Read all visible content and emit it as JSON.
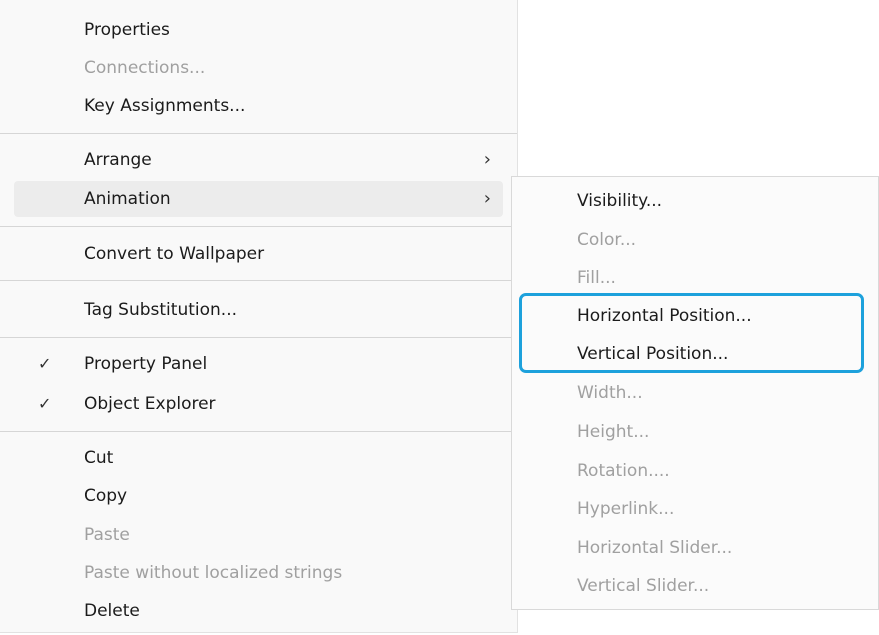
{
  "context_menu": {
    "items": [
      {
        "label": "Properties",
        "enabled": true
      },
      {
        "label": "Connections...",
        "enabled": false
      },
      {
        "label": "Key Assignments...",
        "enabled": true
      },
      {
        "label": "Arrange",
        "enabled": true,
        "submenu": true
      },
      {
        "label": "Animation",
        "enabled": true,
        "submenu": true,
        "hovered": true
      },
      {
        "label": "Convert to Wallpaper",
        "enabled": true
      },
      {
        "label": "Tag Substitution...",
        "enabled": true
      },
      {
        "label": "Property Panel",
        "enabled": true,
        "checked": true
      },
      {
        "label": "Object Explorer",
        "enabled": true,
        "checked": true
      },
      {
        "label": "Cut",
        "enabled": true
      },
      {
        "label": "Copy",
        "enabled": true
      },
      {
        "label": "Paste",
        "enabled": false
      },
      {
        "label": "Paste without localized strings",
        "enabled": false
      },
      {
        "label": "Delete",
        "enabled": true
      }
    ],
    "check_glyph": "✓",
    "chevron_glyph": "›"
  },
  "animation_submenu": {
    "items": [
      {
        "label": "Visibility...",
        "enabled": true
      },
      {
        "label": "Color...",
        "enabled": false
      },
      {
        "label": "Fill...",
        "enabled": false
      },
      {
        "label": "Horizontal Position...",
        "enabled": true,
        "highlighted": true
      },
      {
        "label": "Vertical Position...",
        "enabled": true,
        "highlighted": true
      },
      {
        "label": "Width...",
        "enabled": false
      },
      {
        "label": "Height...",
        "enabled": false
      },
      {
        "label": "Rotation....",
        "enabled": false
      },
      {
        "label": "Hyperlink...",
        "enabled": false
      },
      {
        "label": "Horizontal Slider...",
        "enabled": false
      },
      {
        "label": "Vertical Slider...",
        "enabled": false
      }
    ]
  },
  "colors": {
    "highlight_border": "#1da1dc",
    "disabled_text": "#a0a0a0",
    "text": "#1b1b1b",
    "hover_bg": "#ececec"
  }
}
